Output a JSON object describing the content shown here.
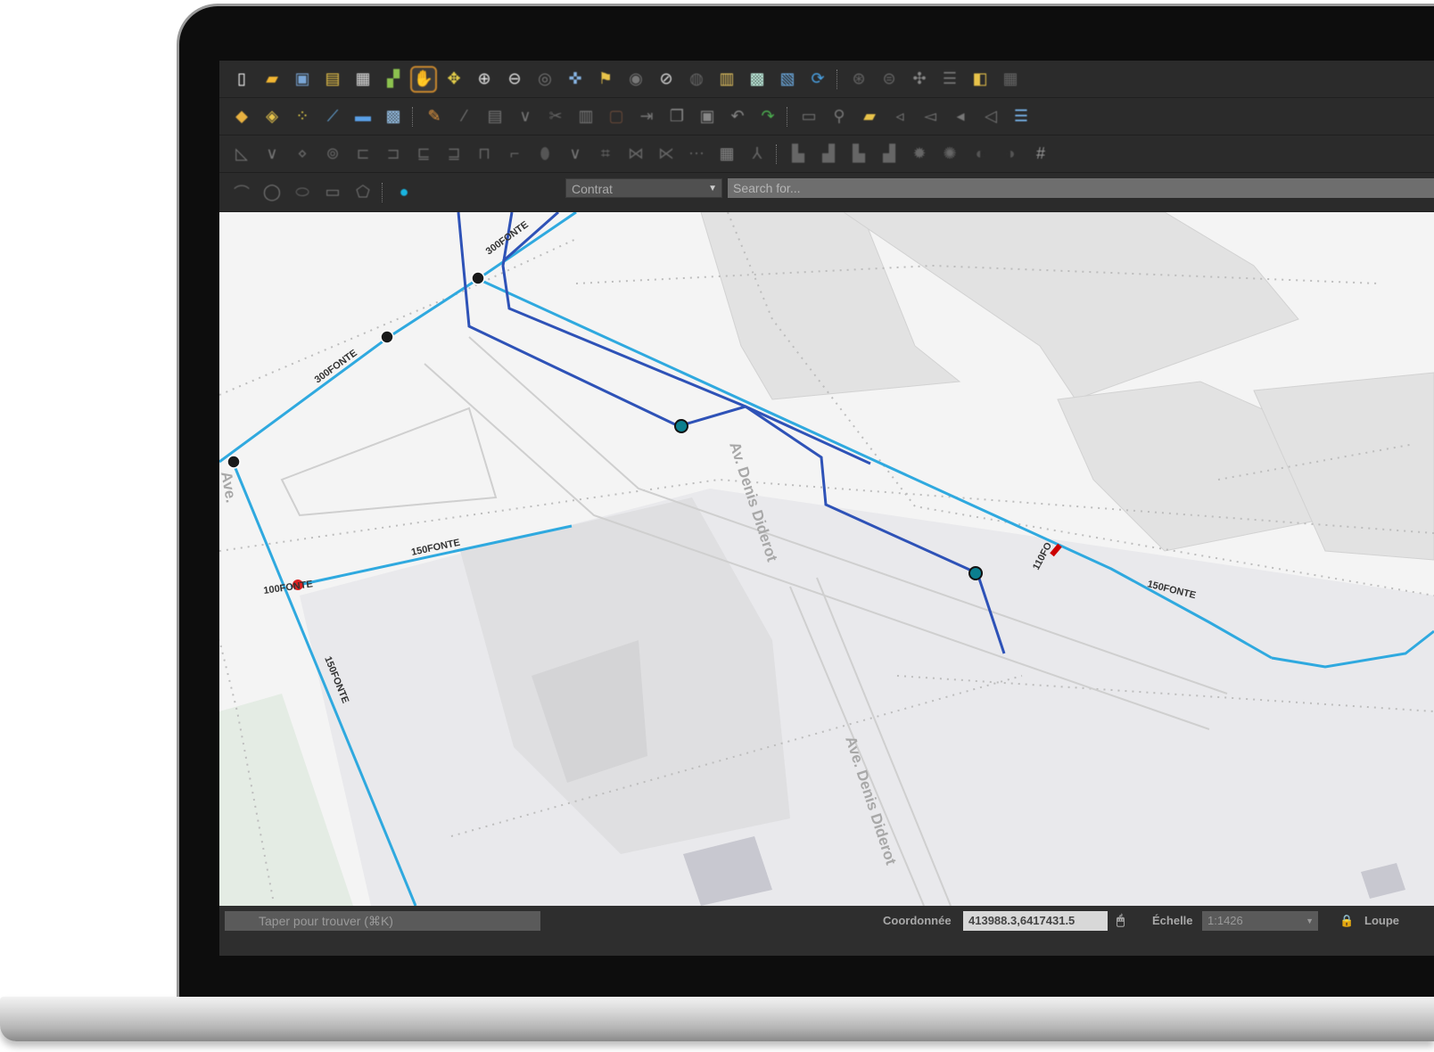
{
  "toolbar": {
    "row1_icons": [
      "new-project-icon",
      "open-folder-icon",
      "save-icon",
      "save-as-icon",
      "print-layout-icon",
      "style-manager-icon",
      "pan-hand-icon",
      "pan-to-selection-icon",
      "zoom-in-icon",
      "zoom-out-icon",
      "zoom-full-icon",
      "zoom-layer-icon",
      "zoom-selection-icon",
      "zoom-last-icon",
      "zoom-next-icon",
      "new-map-view-icon",
      "new-bookmark-icon",
      "show-bookmarks-icon",
      "refresh-icon",
      "identify-icon",
      "measure-icon",
      "select-feature-icon",
      "attribute-table-icon",
      "deselect-icon",
      "statistics-icon",
      "field-calculator-icon"
    ],
    "row2_icons": [
      "add-vector-layer-icon",
      "add-raster-layer-icon",
      "add-point-icon",
      "digitize-icon",
      "add-line-icon",
      "add-polygon-icon",
      "toggle-editing-icon",
      "pencil-icon",
      "save-edits-icon",
      "vertex-tool-icon",
      "cut-icon",
      "copy-features-icon",
      "paste-features-icon",
      "delete-selected-icon",
      "undo-icon",
      "redo-icon",
      "label-icon",
      "pin-label-icon",
      "highlight-label-icon",
      "move-label-icon",
      "rotate-label-icon",
      "change-label-icon",
      "show-label-icon",
      "database-icon"
    ],
    "row3_icons": [
      "angle-icon",
      "vertex-editor-icon",
      "reshape-icon",
      "offset-curve-icon",
      "split-icon",
      "merge-icon",
      "rotate-feature-icon",
      "simplify-icon",
      "add-ring-icon",
      "fill-ring-icon",
      "add-part-icon",
      "delete-ring-icon",
      "delete-part-icon",
      "split-parts-icon",
      "node-tool-icon",
      "trace-icon",
      "grid-icon",
      "snapping-icon",
      "chart-icon",
      "bar-chart-icon",
      "histogram-icon",
      "sun-icon",
      "sun-shade-icon",
      "moon-icon",
      "crosshair-grid-icon"
    ],
    "row4_icons": [
      "curve-tool-icon",
      "circle-tool-icon",
      "ellipse-tool-icon",
      "rectangle-tool-icon",
      "polygon-tool-icon",
      "globe-icon"
    ],
    "contract_select": "Contrat",
    "search_placeholder": "Search for..."
  },
  "map": {
    "labels": {
      "pipe_300_a": "300FONTE",
      "pipe_300_b": "300FONTE",
      "pipe_150_a": "150FONTE",
      "pipe_150_b": "150FONTE",
      "pipe_150_c": "150FONTE",
      "pipe_100": "100FONTE",
      "pipe_110": "110FO",
      "street_top": "Av. Denis Diderot",
      "street_bottom": "Ave. Denis Diderot",
      "street_left": "Ave."
    },
    "colors": {
      "pipe_light": "#2fa9df",
      "pipe_dark": "#2e52b7",
      "background": "#f4f4f4",
      "building": "#dedede"
    }
  },
  "status": {
    "locator_placeholder": "Taper pour trouver (⌘K)",
    "coord_label": "Coordonnée",
    "coord_value": "413988.3,6417431.5",
    "scale_label": "Échelle",
    "scale_value": "1:1426",
    "magnifier_label": "Loupe"
  }
}
